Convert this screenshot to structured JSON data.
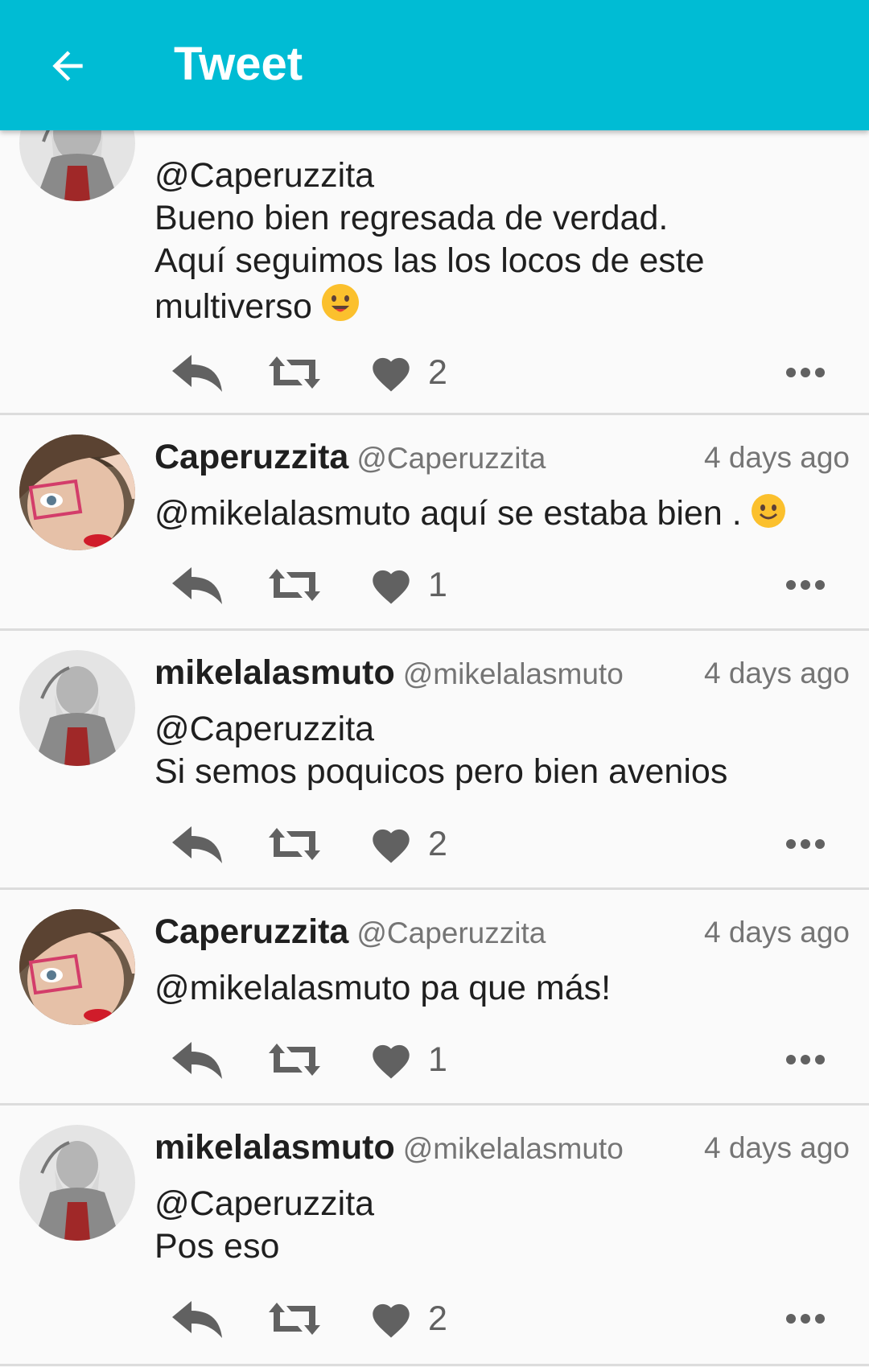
{
  "appbar": {
    "title": "Tweet",
    "background": "#00bcd4",
    "back_icon": "arrow-left-icon"
  },
  "tweets": [
    {
      "author": "",
      "handle": "",
      "time": "",
      "avatar": "templar-statue",
      "lines": [
        "@Caperuzzita",
        "Bueno bien regresada de verdad.",
        "Aquí seguimos las los locos de este",
        "multiverso"
      ],
      "emoji": "smiling-face-emoji",
      "likes": "2"
    },
    {
      "author": "Caperuzzita",
      "handle": "@Caperuzzita",
      "time": "4 days ago",
      "avatar": "woman-glasses",
      "lines": [
        "@mikelalasmuto aquí se estaba bien ."
      ],
      "emoji": "slight-smile-emoji",
      "likes": "1"
    },
    {
      "author": "mikelalasmuto",
      "handle": "@mikelalasmuto",
      "time": "4 days ago",
      "avatar": "templar-statue",
      "lines": [
        "@Caperuzzita",
        "Si semos poquicos pero bien avenios"
      ],
      "emoji": "",
      "likes": "2"
    },
    {
      "author": "Caperuzzita",
      "handle": "@Caperuzzita",
      "time": "4 days ago",
      "avatar": "woman-glasses",
      "lines": [
        "@mikelalasmuto pa que más!"
      ],
      "emoji": "",
      "likes": "1"
    },
    {
      "author": "mikelalasmuto",
      "handle": "@mikelalasmuto",
      "time": "4 days ago",
      "avatar": "templar-statue",
      "lines": [
        "@Caperuzzita",
        "Pos eso"
      ],
      "emoji": "",
      "likes": "2"
    }
  ],
  "action_icons": [
    "reply-icon",
    "retweet-icon",
    "heart-icon",
    "more-icon"
  ],
  "colors": {
    "icon": "#616161",
    "divider": "#dcdcdc",
    "secondary_text": "#757575"
  }
}
